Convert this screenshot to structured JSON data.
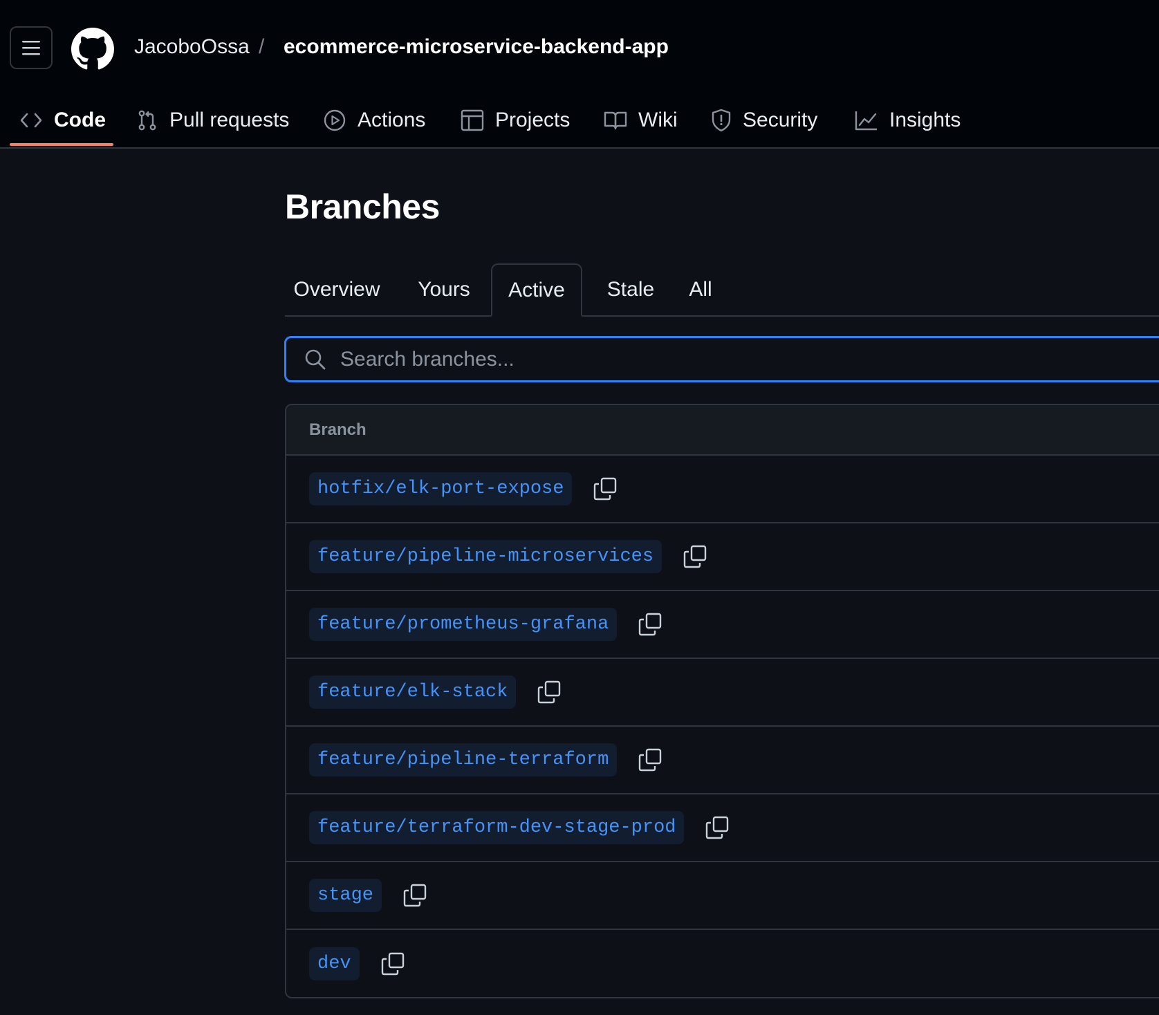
{
  "header": {
    "owner": "JacoboOssa",
    "separator": "/",
    "repo": "ecommerce-microservice-backend-app"
  },
  "nav": [
    {
      "label": "Code",
      "icon": "code-icon",
      "selected": true
    },
    {
      "label": "Pull requests",
      "icon": "git-pull-request-icon"
    },
    {
      "label": "Actions",
      "icon": "play-icon"
    },
    {
      "label": "Projects",
      "icon": "table-icon"
    },
    {
      "label": "Wiki",
      "icon": "book-icon"
    },
    {
      "label": "Security",
      "icon": "shield-icon"
    },
    {
      "label": "Insights",
      "icon": "graph-icon"
    }
  ],
  "page": {
    "title": "Branches"
  },
  "tabs": [
    {
      "label": "Overview"
    },
    {
      "label": "Yours"
    },
    {
      "label": "Active",
      "selected": true
    },
    {
      "label": "Stale"
    },
    {
      "label": "All"
    }
  ],
  "search": {
    "placeholder": "Search branches..."
  },
  "table": {
    "header": "Branch",
    "rows": [
      "hotfix/elk-port-expose",
      "feature/pipeline-microservices",
      "feature/prometheus-grafana",
      "feature/elk-stack",
      "feature/pipeline-terraform",
      "feature/terraform-dev-stage-prod",
      "stage",
      "dev"
    ]
  },
  "colors": {
    "background": "#0d1117",
    "header_bg": "#010409",
    "accent_underline": "#f78166",
    "focus_border": "#2f81f7",
    "branch_text": "#4493f8",
    "branch_bg": "#121d2f"
  }
}
